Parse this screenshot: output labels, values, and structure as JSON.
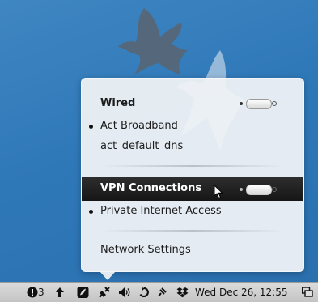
{
  "menu": {
    "wired": {
      "label": "Wired",
      "toggle_on": true
    },
    "connections": [
      {
        "label": "Act Broadband",
        "active": true
      },
      {
        "label": "act_default_dns",
        "active": false
      }
    ],
    "vpn": {
      "label": "VPN Connections",
      "toggle_on": true
    },
    "vpn_connections": [
      {
        "label": "Private Internet Access",
        "active": true
      }
    ],
    "settings_label": "Network Settings"
  },
  "panel": {
    "notification_count": "3",
    "clock": "Wed Dec 26, 12:55",
    "icons": [
      "alert-icon",
      "upload-arrow-icon",
      "tomboy-note-icon",
      "network-icon",
      "volume-icon",
      "sync-icon",
      "pin-icon",
      "dropbox-icon",
      "window-list-icon"
    ]
  },
  "colors": {
    "highlight": "#1e1e1e",
    "menu_bg": "#f2f4f6",
    "wallpaper": "#2f78b8"
  }
}
